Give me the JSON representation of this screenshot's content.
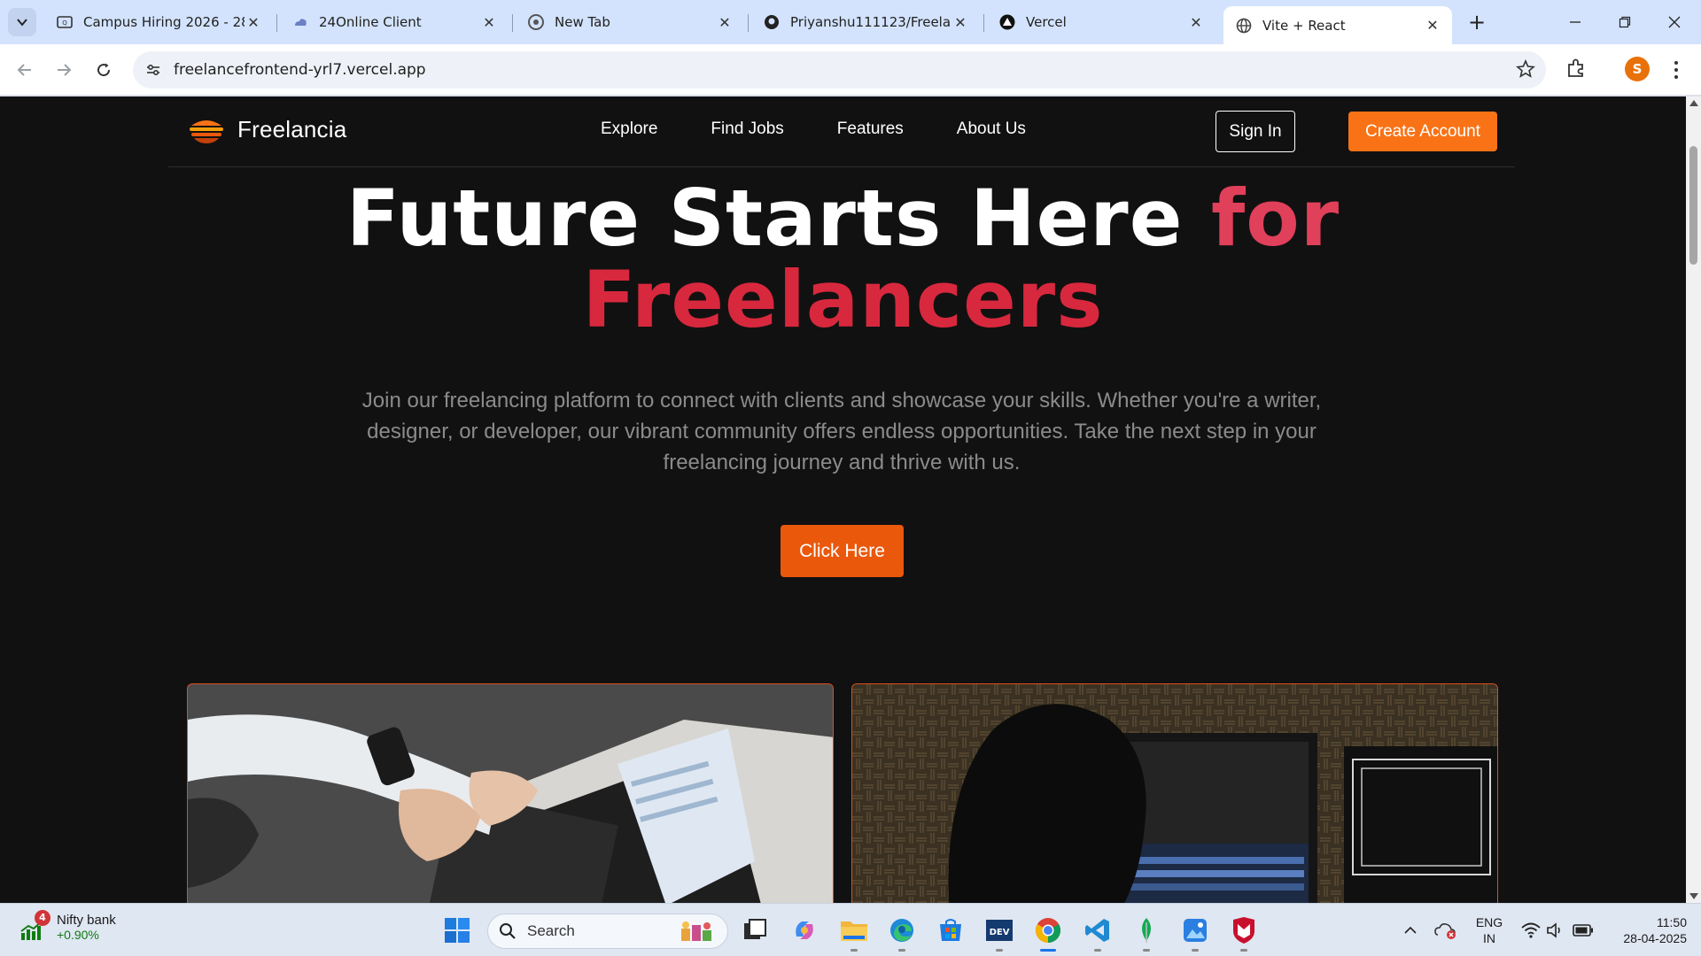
{
  "browser": {
    "tabs": [
      {
        "title": "Campus Hiring 2026 - 28 A",
        "icon": "quiz-icon"
      },
      {
        "title": "24Online Client",
        "icon": "cloud-icon"
      },
      {
        "title": "New Tab",
        "icon": "chrome-icon"
      },
      {
        "title": "Priyanshu111123/Freelanc",
        "icon": "github-icon"
      },
      {
        "title": "Vercel",
        "icon": "vercel-icon"
      },
      {
        "title": "Vite + React",
        "icon": "globe-icon",
        "active": true
      }
    ],
    "address": "freelancefrontend-yrl7.vercel.app",
    "profile_initial": "S"
  },
  "site": {
    "brand": "Freelancia",
    "nav": [
      "Explore",
      "Find Jobs",
      "Features",
      "About Us"
    ],
    "sign_in": "Sign In",
    "create_account": "Create Account"
  },
  "hero": {
    "title_white": "Future Starts Here ",
    "title_accent1": "for",
    "title_accent2": "Freelancers",
    "subtitle": "Join our freelancing platform to connect with clients and showcase your skills. Whether you're a writer, designer, or developer, our vibrant community offers endless opportunities. Take the next step in your freelancing journey and thrive with us.",
    "cta": "Click Here"
  },
  "colors": {
    "accent_orange": "#f97316",
    "accent_red": "#e0405a",
    "page_bg": "#121111"
  },
  "taskbar": {
    "widget_title": "Nifty bank",
    "widget_change": "+0.90%",
    "widget_badge": "4",
    "search_label": "Search",
    "lang_top": "ENG",
    "lang_bottom": "IN",
    "time": "11:50",
    "date": "28-04-2025"
  }
}
